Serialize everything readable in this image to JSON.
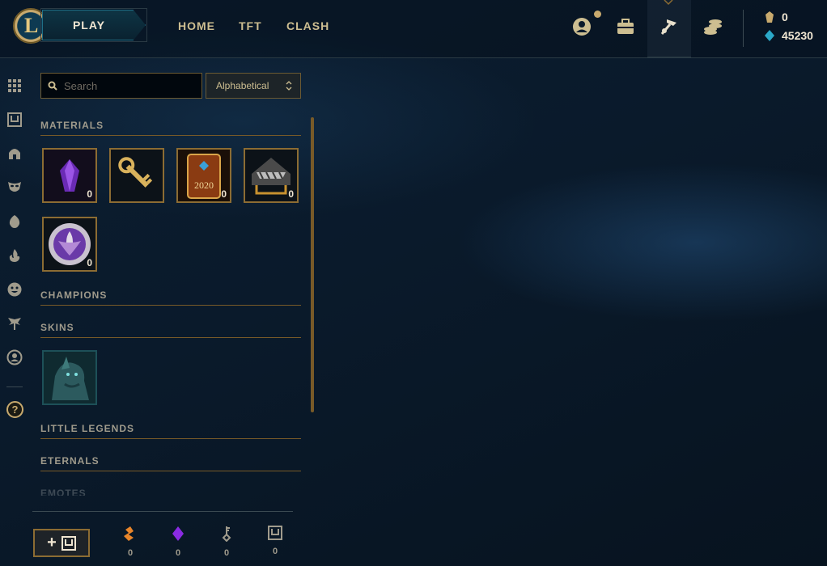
{
  "header": {
    "play_label": "PLAY",
    "nav": [
      "HOME",
      "TFT",
      "CLASH"
    ],
    "icons": [
      "profile-icon",
      "collection-icon",
      "loot-icon",
      "store-icon"
    ],
    "currency": {
      "blue_essence": "0",
      "riot_points": "45230"
    }
  },
  "sidebar": {
    "icons": [
      "grid-icon",
      "chest-icon",
      "helmet-icon",
      "mask-icon",
      "egg-icon",
      "flame-icon",
      "emote-icon",
      "tree-icon",
      "avatar-icon"
    ],
    "help_label": "?"
  },
  "loot": {
    "search_placeholder": "Search",
    "sort_label": "Alphabetical",
    "categories": {
      "materials": "MATERIALS",
      "champions": "CHAMPIONS",
      "skins": "SKINS",
      "little_legends": "LITTLE LEGENDS",
      "eternals": "ETERNALS",
      "emotes": "EMOTES"
    },
    "materials": [
      {
        "name": "purple-crystal",
        "count": "0"
      },
      {
        "name": "gold-key",
        "count": ""
      },
      {
        "name": "2020-card",
        "count": "0",
        "label": "2020"
      },
      {
        "name": "chest",
        "count": "0"
      },
      {
        "name": "purple-orb",
        "count": "0"
      }
    ]
  },
  "bottom": {
    "add_label": "+",
    "resources": [
      {
        "name": "orange-essence-icon",
        "count": "0",
        "color": "#e8852a"
      },
      {
        "name": "mythic-essence-icon",
        "count": "0",
        "color": "#8a2be2"
      },
      {
        "name": "key-fragment-icon",
        "count": "0",
        "color": "#a09b8c"
      },
      {
        "name": "chest-outline-icon",
        "count": "0",
        "color": "#a09b8c"
      }
    ]
  }
}
